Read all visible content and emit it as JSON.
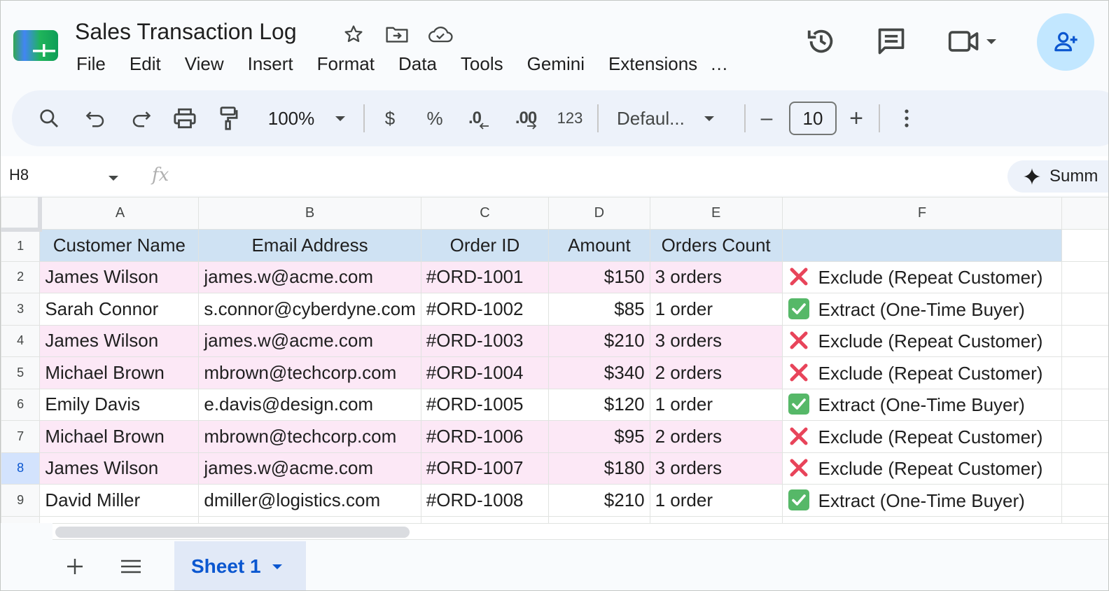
{
  "app": {
    "doc_title": "Sales Transaction Log",
    "menus": [
      "File",
      "Edit",
      "View",
      "Insert",
      "Format",
      "Data",
      "Tools",
      "Gemini",
      "Extensions",
      "…"
    ]
  },
  "toolbar": {
    "zoom": "100%",
    "currency": "$",
    "percent": "%",
    "decrease_decimal": ".0",
    "increase_decimal": ".00",
    "number_format": "123",
    "font": "Defaul...",
    "font_size": "10",
    "minus": "–",
    "plus": "+"
  },
  "formula_bar": {
    "cell_ref": "H8",
    "fx": "fx",
    "summarize": "Summ"
  },
  "columns": [
    "A",
    "B",
    "C",
    "D",
    "E",
    "F"
  ],
  "header_row": {
    "row_number": "1",
    "cells": [
      "Customer Name",
      "Email Address",
      "Order ID",
      "Amount",
      "Orders Count",
      ""
    ]
  },
  "rows": [
    {
      "n": "2",
      "name": "James Wilson",
      "email": "james.w@acme.com",
      "order": "#ORD-1001",
      "amount": "$150",
      "count": "3 orders",
      "status_icon": "cross-mark-icon",
      "status": "Exclude (Repeat Customer)",
      "highlight": true
    },
    {
      "n": "3",
      "name": "Sarah Connor",
      "email": "s.connor@cyberdyne.com",
      "order": "#ORD-1002",
      "amount": "$85",
      "count": "1 order",
      "status_icon": "check-mark-icon",
      "status": "Extract (One-Time Buyer)",
      "highlight": false
    },
    {
      "n": "4",
      "name": "James Wilson",
      "email": "james.w@acme.com",
      "order": "#ORD-1003",
      "amount": "$210",
      "count": "3 orders",
      "status_icon": "cross-mark-icon",
      "status": "Exclude (Repeat Customer)",
      "highlight": true
    },
    {
      "n": "5",
      "name": "Michael Brown",
      "email": "mbrown@techcorp.com",
      "order": "#ORD-1004",
      "amount": "$340",
      "count": "2 orders",
      "status_icon": "cross-mark-icon",
      "status": "Exclude (Repeat Customer)",
      "highlight": true
    },
    {
      "n": "6",
      "name": "Emily Davis",
      "email": "e.davis@design.com",
      "order": "#ORD-1005",
      "amount": "$120",
      "count": "1 order",
      "status_icon": "check-mark-icon",
      "status": "Extract (One-Time Buyer)",
      "highlight": false
    },
    {
      "n": "7",
      "name": "Michael Brown",
      "email": "mbrown@techcorp.com",
      "order": "#ORD-1006",
      "amount": "$95",
      "count": "2 orders",
      "status_icon": "cross-mark-icon",
      "status": "Exclude (Repeat Customer)",
      "highlight": true
    },
    {
      "n": "8",
      "name": "James Wilson",
      "email": "james.w@acme.com",
      "order": "#ORD-1007",
      "amount": "$180",
      "count": "3 orders",
      "status_icon": "cross-mark-icon",
      "status": "Exclude (Repeat Customer)",
      "highlight": true,
      "selected": true
    },
    {
      "n": "9",
      "name": "David Miller",
      "email": "dmiller@logistics.com",
      "order": "#ORD-1008",
      "amount": "$210",
      "count": "1 order",
      "status_icon": "check-mark-icon",
      "status": "Extract (One-Time Buyer)",
      "highlight": false
    }
  ],
  "sheets": {
    "active": "Sheet 1"
  },
  "colors": {
    "header_fill": "#cfe2f3",
    "repeat_fill": "#fce8f6",
    "accent": "#0b57d0",
    "share_bg": "#c2e7ff"
  }
}
